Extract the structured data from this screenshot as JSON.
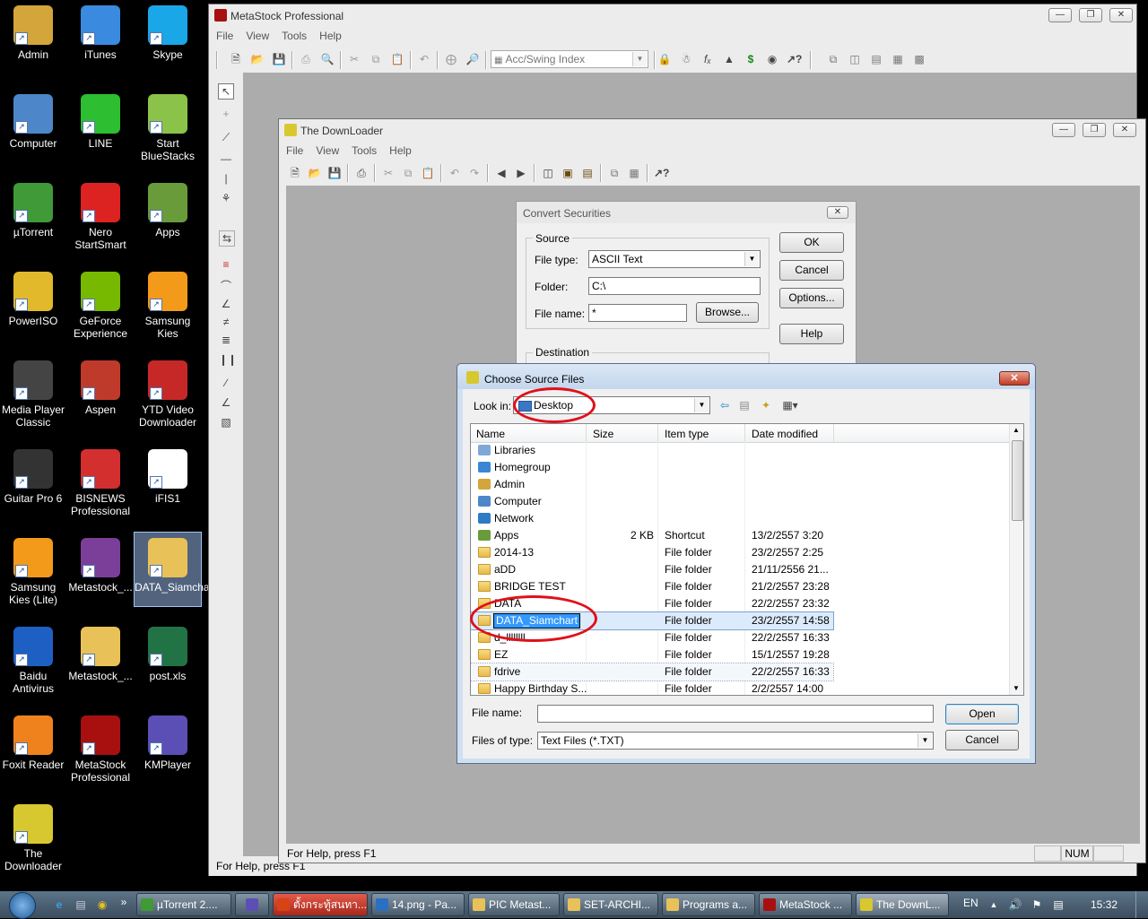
{
  "desktop_icons": [
    {
      "label": "Admin",
      "color": "#d4a53a"
    },
    {
      "label": "iTunes",
      "color": "#3a8ae0"
    },
    {
      "label": "Skype",
      "color": "#1aa7e8"
    },
    {
      "label": "Computer",
      "color": "#4d86c9"
    },
    {
      "label": "LINE",
      "color": "#2dbe32"
    },
    {
      "label": "Start BlueStacks",
      "color": "#8bc34a"
    },
    {
      "label": "µTorrent",
      "color": "#3f9a37"
    },
    {
      "label": "Nero StartSmart",
      "color": "#d22"
    },
    {
      "label": "Apps",
      "color": "#6a9b3a"
    },
    {
      "label": "PowerISO",
      "color": "#e2b92a"
    },
    {
      "label": "GeForce Experience",
      "color": "#76b900"
    },
    {
      "label": "Samsung Kies",
      "color": "#f39a1b"
    },
    {
      "label": "Media Player Classic",
      "color": "#444"
    },
    {
      "label": "Aspen",
      "color": "#c03a2b"
    },
    {
      "label": "YTD Video Downloader",
      "color": "#c62828"
    },
    {
      "label": "Guitar Pro 6",
      "color": "#333"
    },
    {
      "label": "BISNEWS Professional",
      "color": "#d32f2f"
    },
    {
      "label": "iFIS1",
      "color": "#ffffff"
    },
    {
      "label": "Samsung Kies (Lite)",
      "color": "#f39a1b"
    },
    {
      "label": "Metastock_...",
      "color": "#7b3f9a"
    },
    {
      "label": "DATA_Siamchart",
      "color": "#e8c258"
    },
    {
      "label": "Baidu Antivirus",
      "color": "#1e5fc4"
    },
    {
      "label": "Metastock_...",
      "color": "#e8c258"
    },
    {
      "label": "post.xls",
      "color": "#217346"
    },
    {
      "label": "Foxit Reader",
      "color": "#f0821e"
    },
    {
      "label": "MetaStock Professional",
      "color": "#a81010"
    },
    {
      "label": "KMPlayer",
      "color": "#5b4fb5"
    },
    {
      "label": "The Downloader",
      "color": "#d8c830"
    }
  ],
  "metastock": {
    "title": "MetaStock Professional",
    "menu": [
      "File",
      "View",
      "Tools",
      "Help"
    ],
    "indicator_combo": "Acc/Swing Index",
    "status": "For Help, press F1"
  },
  "downloader": {
    "title": "The DownLoader",
    "menu": [
      "File",
      "View",
      "Tools",
      "Help"
    ],
    "status": "For Help, press F1",
    "num": "NUM"
  },
  "convert": {
    "title": "Convert Securities",
    "source_group": "Source",
    "file_type_label": "File type:",
    "file_type_value": "ASCII Text",
    "folder_label": "Folder:",
    "folder_value": "C:\\",
    "file_name_label": "File name:",
    "file_name_value": "*",
    "browse": "Browse...",
    "destination_group": "Destination",
    "ok": "OK",
    "cancel": "Cancel",
    "options": "Options...",
    "help": "Help"
  },
  "choose": {
    "title": "Choose Source Files",
    "look_in_label": "Look in:",
    "look_in_value": "Desktop",
    "columns": [
      "Name",
      "Size",
      "Item type",
      "Date modified"
    ],
    "rows": [
      {
        "name": "Libraries",
        "size": "",
        "type": "",
        "date": "",
        "icon": "#7fa8d8"
      },
      {
        "name": "Homegroup",
        "size": "",
        "type": "",
        "date": "",
        "icon": "#3a86d4"
      },
      {
        "name": "Admin",
        "size": "",
        "type": "",
        "date": "",
        "icon": "#d4a53a"
      },
      {
        "name": "Computer",
        "size": "",
        "type": "",
        "date": "",
        "icon": "#4d86c9"
      },
      {
        "name": "Network",
        "size": "",
        "type": "",
        "date": "",
        "icon": "#2e7bc4"
      },
      {
        "name": "Apps",
        "size": "2 KB",
        "type": "Shortcut",
        "date": "13/2/2557 3:20",
        "icon": "#6a9b3a"
      },
      {
        "name": "2014-13",
        "size": "",
        "type": "File folder",
        "date": "23/2/2557 2:25",
        "icon": "folder"
      },
      {
        "name": "aDD",
        "size": "",
        "type": "File folder",
        "date": "21/11/2556 21...",
        "icon": "folder"
      },
      {
        "name": "BRIDGE TEST",
        "size": "",
        "type": "File folder",
        "date": "21/2/2557 23:28",
        "icon": "folder"
      },
      {
        "name": "DATA",
        "size": "",
        "type": "File folder",
        "date": "22/2/2557 23:32",
        "icon": "folder"
      },
      {
        "name": "DATA_Siamchart",
        "size": "",
        "type": "File folder",
        "date": "23/2/2557 14:58",
        "icon": "folder"
      },
      {
        "name": "d_llllllll",
        "size": "",
        "type": "File folder",
        "date": "22/2/2557 16:33",
        "icon": "folder"
      },
      {
        "name": "EZ",
        "size": "",
        "type": "File folder",
        "date": "15/1/2557 19:28",
        "icon": "folder"
      },
      {
        "name": "fdrive",
        "size": "",
        "type": "File folder",
        "date": "22/2/2557 16:33",
        "icon": "folder"
      },
      {
        "name": "Happy Birthday S...",
        "size": "",
        "type": "File folder",
        "date": "2/2/2557 14:00",
        "icon": "folder"
      }
    ],
    "file_name_label": "File name:",
    "file_name_value": "",
    "files_of_type_label": "Files of type:",
    "files_of_type_value": "Text Files (*.TXT)",
    "open": "Open",
    "cancel": "Cancel"
  },
  "taskbar": {
    "items": [
      {
        "label": "µTorrent 2....",
        "color": "#3f9a37"
      },
      {
        "label": "",
        "color": "#5b4fb5"
      },
      {
        "label": "ตั้งกระทู้สนทา...",
        "color": "#d84315"
      },
      {
        "label": "14.png - Pa...",
        "color": "#2a6fc1"
      },
      {
        "label": "PIC Metast...",
        "color": "#e8c258"
      },
      {
        "label": "SET-ARCHI...",
        "color": "#e8c258"
      },
      {
        "label": "Programs a...",
        "color": "#e8c258"
      },
      {
        "label": "MetaStock ...",
        "color": "#a81010"
      },
      {
        "label": "The DownL...",
        "color": "#d8c830"
      }
    ],
    "lang": "EN",
    "time": "15:32"
  },
  "colors": {
    "accent": "#3399ff",
    "highlight_circle": "#e0101a"
  }
}
